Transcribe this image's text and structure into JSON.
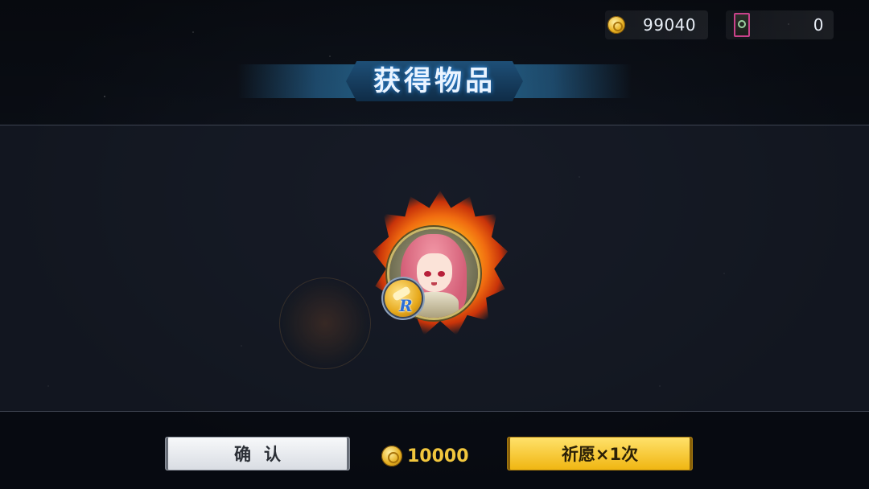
{
  "currency": {
    "gold": {
      "icon": "gold-coin-icon",
      "value": "99040"
    },
    "ticket": {
      "icon": "summon-ticket-icon",
      "value": "0"
    }
  },
  "header": {
    "title": "获得物品"
  },
  "reward": {
    "rank_letter": "R",
    "portrait_icon": "character-portrait"
  },
  "actions": {
    "confirm_label": "确认",
    "cost_value": "10000",
    "cost_icon": "gold-coin-icon",
    "wish_label": "祈愿×1次"
  },
  "colors": {
    "accent_gold": "#f1c63d",
    "banner_blue": "#1e4f77",
    "wish_button": "#f0b612"
  }
}
